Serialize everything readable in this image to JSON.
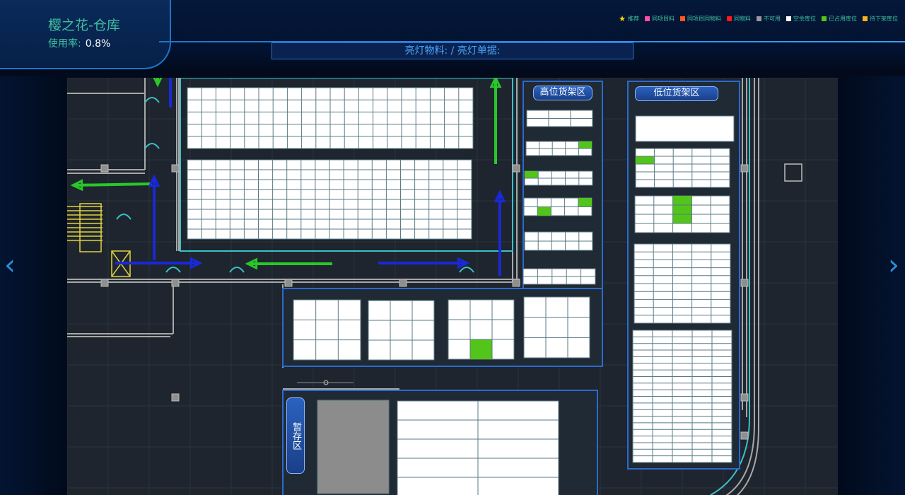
{
  "header": {
    "title": "樱之花-仓库",
    "usage_label": "使用率:",
    "usage_value": "0.8%",
    "light_bar_text": "亮灯物料:  / 亮灯单据:"
  },
  "legend": [
    {
      "icon": "star-icon",
      "color": "#ffe000",
      "label": "推荐"
    },
    {
      "icon": "square-icon",
      "color": "#ff4fa8",
      "label": "同项目料"
    },
    {
      "icon": "square-icon",
      "color": "#ff5a1a",
      "label": "同项目同物料"
    },
    {
      "icon": "square-icon",
      "color": "#ff1a1a",
      "label": "同物料"
    },
    {
      "icon": "square-icon",
      "color": "#9a9a9a",
      "label": "不可用"
    },
    {
      "icon": "square-icon",
      "color": "#ffffff",
      "label": "空余库位"
    },
    {
      "icon": "square-icon",
      "color": "#52c41a",
      "label": "已占用库位"
    },
    {
      "icon": "square-icon",
      "color": "#ffb21a",
      "label": "待下架库位"
    }
  ],
  "zones": {
    "high_shelf": "高位货架区",
    "low_shelf": "低位货架区",
    "temp_storage": "暂存区"
  },
  "colors": {
    "empty": "#ffffff",
    "occupied": "#52c41a",
    "unavailable": "#8c8c8c",
    "cell_border": "#5a7a86"
  }
}
